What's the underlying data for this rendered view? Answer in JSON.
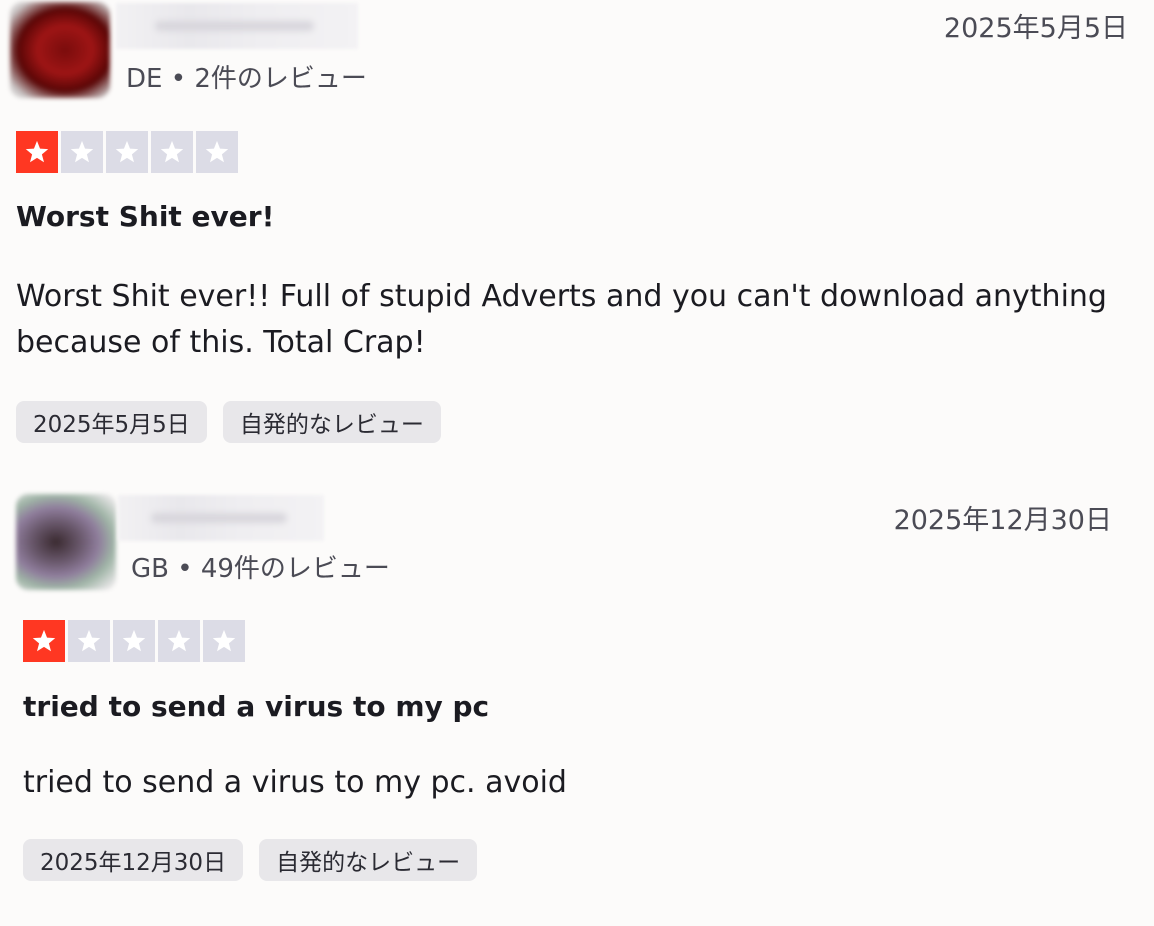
{
  "reviews": [
    {
      "meta": "DE • 2件のレビュー",
      "date": "2025年5月5日",
      "rating": 1,
      "title": "Worst Shit ever!",
      "body": "Worst Shit ever!! Full of stupid Adverts and you can't download anything because of this. Total Crap!",
      "tag_date": "2025年5月5日",
      "tag_type": "自発的なレビュー"
    },
    {
      "meta": "GB • 49件のレビュー",
      "date": "2025年12月30日",
      "rating": 1,
      "title": "tried to send a virus to my pc",
      "body": "tried to send a virus to my pc. avoid",
      "tag_date": "2025年12月30日",
      "tag_type": "自発的なレビュー"
    }
  ],
  "colors": {
    "star_filled": "#ff3722",
    "star_empty": "#dcdce6",
    "tag_bg": "#e8e7ea"
  },
  "icons": {
    "star": "star-icon"
  }
}
